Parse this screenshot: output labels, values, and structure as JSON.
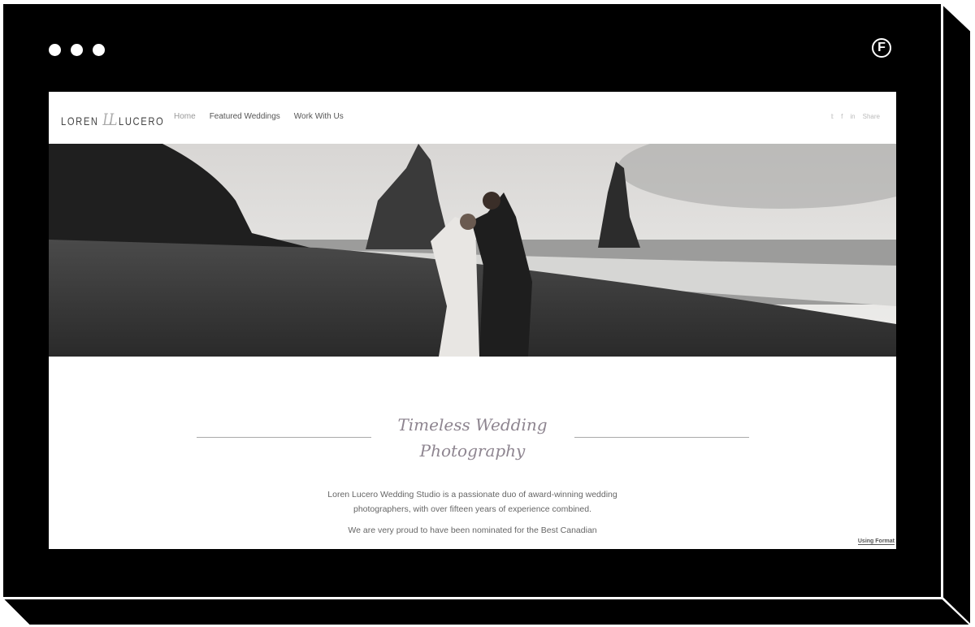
{
  "window": {
    "controls": [
      "close",
      "minimize",
      "maximize"
    ],
    "brand_icon": "format-f-logo",
    "brand_letter": "F"
  },
  "site": {
    "logo": {
      "left": "LOREN",
      "monogram": "LL",
      "right": "LUCERO"
    },
    "nav": [
      {
        "label": "Home",
        "active": true
      },
      {
        "label": "Featured Weddings"
      },
      {
        "label": "Work With Us"
      }
    ],
    "social": {
      "icons": [
        "twitter-icon",
        "facebook-icon",
        "linkedin-icon"
      ],
      "twitter": "𝕥",
      "facebook": "f",
      "linkedin": "in",
      "share_label": "Share"
    },
    "hero": {
      "description": "black and white photo of couple kissing on black sand beach with sea stacks"
    },
    "heading_line1": "Timeless Wedding",
    "heading_line2": "Photography",
    "paragraphs": [
      "Loren Lucero Wedding Studio is a passionate duo of award-winning wedding photographers, with over fifteen years of experience combined.",
      "We are very proud to have been nominated for the Best Canadian"
    ],
    "badge": "Using Format",
    "colors": {
      "heading": "#8e8590",
      "frame": "#000000"
    }
  }
}
